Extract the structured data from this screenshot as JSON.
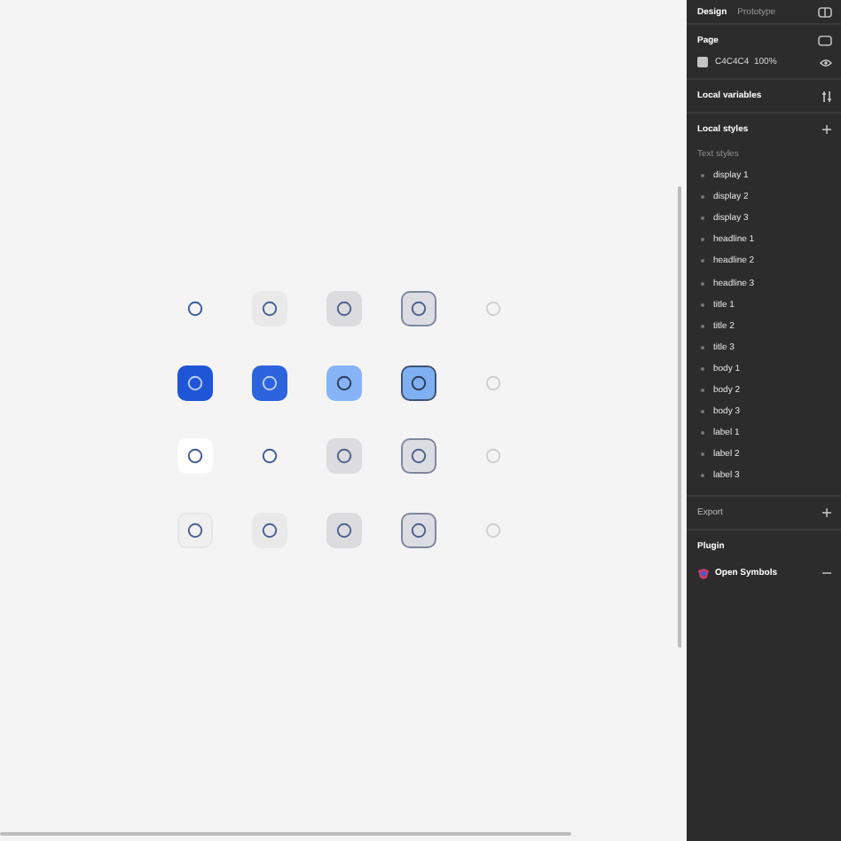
{
  "canvas": {
    "rows": [
      {
        "cells": [
          {
            "kind": "plain"
          },
          {
            "kind": "soft"
          },
          {
            "kind": "grey"
          },
          {
            "kind": "outlined"
          },
          {
            "kind": "disabled"
          }
        ]
      },
      {
        "cells": [
          {
            "kind": "primary"
          },
          {
            "kind": "primary-hover"
          },
          {
            "kind": "tonal"
          },
          {
            "kind": "tonal-outlined"
          },
          {
            "kind": "disabled"
          }
        ]
      },
      {
        "cells": [
          {
            "kind": "white"
          },
          {
            "kind": "plain"
          },
          {
            "kind": "grey"
          },
          {
            "kind": "outlined"
          },
          {
            "kind": "disabled"
          }
        ]
      },
      {
        "cells": [
          {
            "kind": "faint"
          },
          {
            "kind": "soft"
          },
          {
            "kind": "grey"
          },
          {
            "kind": "outlined"
          },
          {
            "kind": "disabled"
          }
        ]
      }
    ]
  },
  "panel": {
    "tabs": [
      {
        "label": "Design",
        "selected": true
      },
      {
        "label": "Prototype",
        "selected": false
      }
    ],
    "page": {
      "title": "Page",
      "hex": "C4C4C4",
      "opacity": "100%"
    },
    "local_variables": {
      "title": "Local variables"
    },
    "local_styles": {
      "title": "Local styles",
      "group": "Text styles",
      "items": [
        "display 1",
        "display 2",
        "display 3",
        "headline 1",
        "headline 2",
        "headline 3",
        "title 1",
        "title 2",
        "title 3",
        "body 1",
        "body 2",
        "body 3",
        "label 1",
        "label 2",
        "label 3"
      ]
    },
    "export": {
      "title": "Export"
    },
    "plugin": {
      "title": "Plugin",
      "name": "Open Symbols"
    }
  }
}
